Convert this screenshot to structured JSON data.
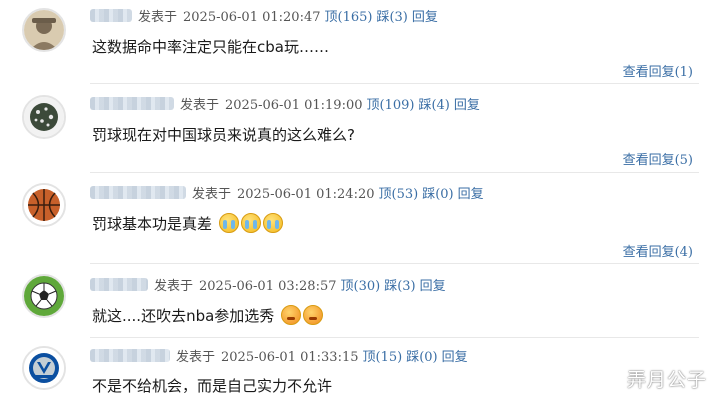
{
  "comments": [
    {
      "posted_prefix": "发表于",
      "timestamp": "2025-06-01 01:20:47",
      "upvote": "顶(165)",
      "downvote": "踩(3)",
      "reply": "回复",
      "text": "这数据命中率注定只能在cba玩……",
      "view_replies": "查看回复(1)",
      "avatar_icon": "person-photo-icon"
    },
    {
      "posted_prefix": "发表于",
      "timestamp": "2025-06-01 01:19:00",
      "upvote": "顶(109)",
      "downvote": "踩(4)",
      "reply": "回复",
      "text": "罚球现在对中国球员来说真的这么难么?",
      "view_replies": "查看回复(5)",
      "avatar_icon": "planet-icon"
    },
    {
      "posted_prefix": "发表于",
      "timestamp": "2025-06-01 01:24:20",
      "upvote": "顶(53)",
      "downvote": "踩(0)",
      "reply": "回复",
      "text": "罚球基本功是真差",
      "view_replies": "查看回复(4)",
      "avatar_icon": "basketball-icon"
    },
    {
      "posted_prefix": "发表于",
      "timestamp": "2025-06-01 03:28:57",
      "upvote": "顶(30)",
      "downvote": "踩(3)",
      "reply": "回复",
      "text": "就这....还吹去nba参加选秀",
      "avatar_icon": "soccer-ball-icon"
    },
    {
      "posted_prefix": "发表于",
      "timestamp": "2025-06-01 01:33:15",
      "upvote": "顶(15)",
      "downvote": "踩(0)",
      "reply": "回复",
      "text": "不是不给机会，而是自己实力不允许",
      "avatar_icon": "mavericks-logo-icon"
    }
  ],
  "watermark": "弄月公子",
  "colors": {
    "link": "#3a6ea5",
    "divider": "#e8e8e8",
    "meta": "#555555"
  }
}
